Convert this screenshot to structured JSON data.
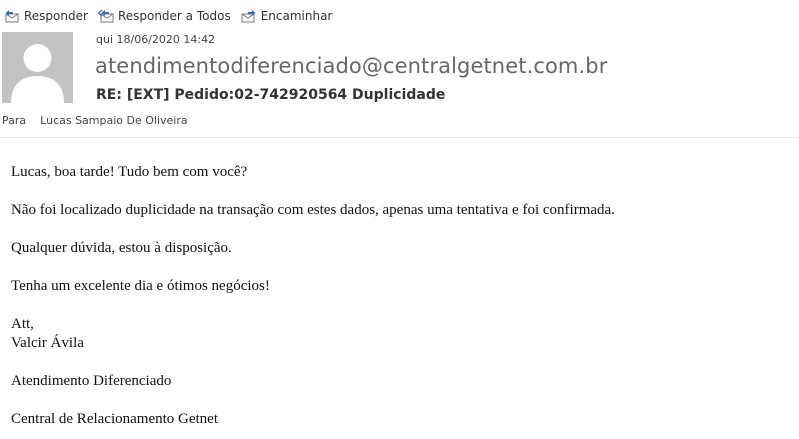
{
  "toolbar": {
    "reply_label": "Responder",
    "reply_all_label": "Responder a Todos",
    "forward_label": "Encaminhar"
  },
  "message": {
    "date": "qui 18/06/2020 14:42",
    "sender": "atendimentodiferenciado@centralgetnet.com.br",
    "subject": "RE: [EXT] Pedido:02-742920564 Duplicidade",
    "to_label": "Para",
    "to_value": "Lucas Sampaio De Oliveira"
  },
  "body": {
    "greeting": "Lucas, boa tarde! Tudo bem com você?",
    "paragraph1": "Não foi localizado duplicidade na transação com estes dados, apenas uma tentativa e foi confirmada.",
    "paragraph2": "Qualquer dúvida, estou à disposição.",
    "paragraph3": "Tenha um excelente dia e ótimos negócios!",
    "signoff": "Att,",
    "signature_name": "Valcir Ávila",
    "department": "Atendimento Diferenciado",
    "company": "Central de Relacionamento Getnet"
  },
  "colors": {
    "icon_blue": "#3c6cb4",
    "avatar_bg": "#c3c3c3"
  }
}
